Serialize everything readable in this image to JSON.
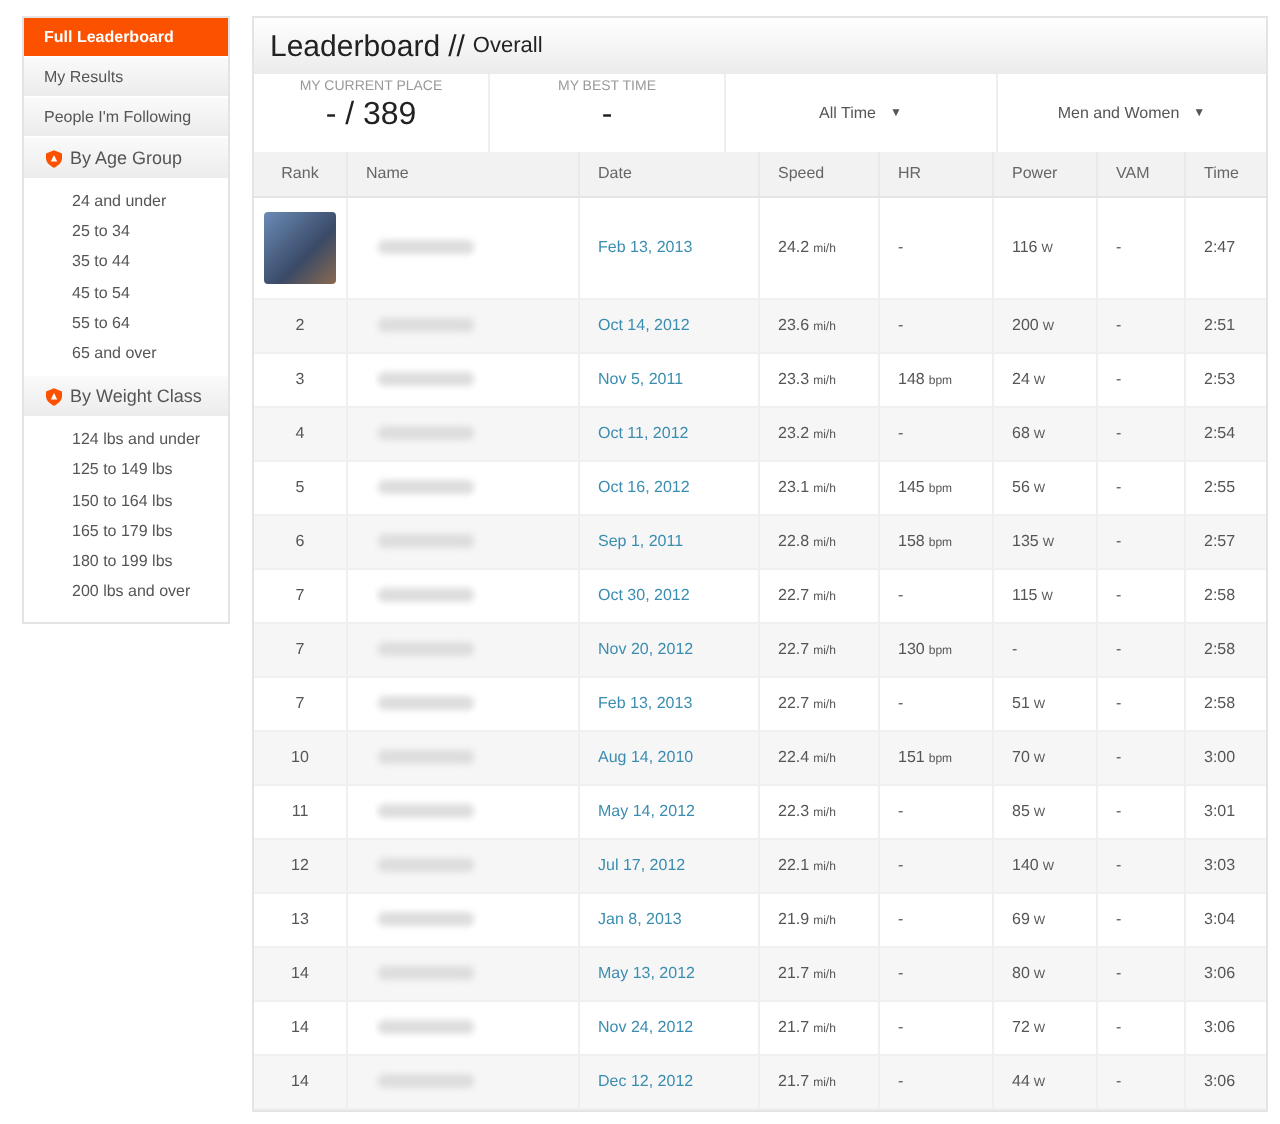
{
  "sidebar": {
    "items": [
      {
        "label": "Full Leaderboard",
        "kind": "link",
        "selected": true
      },
      {
        "label": "My Results",
        "kind": "link",
        "selected": false
      },
      {
        "label": "People I'm Following",
        "kind": "link",
        "selected": false
      },
      {
        "label": "By Age Group",
        "kind": "group",
        "selected": false,
        "children": [
          {
            "label": "24 and under",
            "selected": false
          },
          {
            "label": "25 to 34",
            "selected": false
          },
          {
            "label": "35 to 44",
            "selected": false
          },
          {
            "label": "45 to 54",
            "selected": false
          },
          {
            "label": "55 to 64",
            "selected": false
          },
          {
            "label": "65 and over",
            "selected": false
          }
        ]
      },
      {
        "label": "By Weight Class",
        "kind": "group",
        "selected": false,
        "children": [
          {
            "label": "124 lbs and under",
            "selected": false
          },
          {
            "label": "125 to 149 lbs",
            "selected": false
          },
          {
            "label": "150 to 164 lbs",
            "selected": false
          },
          {
            "label": "165 to 179 lbs",
            "selected": false
          },
          {
            "label": "180 to 199 lbs",
            "selected": false
          },
          {
            "label": "200 lbs and over",
            "selected": false
          }
        ]
      }
    ]
  },
  "header": {
    "title": "Leaderboard",
    "separator": "//",
    "subtitle": "Overall"
  },
  "stats": [
    {
      "label": "MY CURRENT PLACE",
      "value": "- / 389"
    },
    {
      "label": "MY BEST TIME",
      "value": "-"
    }
  ],
  "filters": [
    {
      "label": "All Time",
      "caret": "▼"
    },
    {
      "label": "Men and Women",
      "caret": "▼"
    }
  ],
  "table": {
    "columns": [
      "Rank",
      "Name",
      "Date",
      "Speed",
      "HR",
      "Power",
      "VAM",
      "Time"
    ],
    "rows": [
      {
        "kind": "photo",
        "date": "Feb 13, 2013",
        "speed": {
          "value": "24.2",
          "unit": "mi/h"
        },
        "hr": {
          "value": "-"
        },
        "power": {
          "value": "116",
          "unit": "W"
        },
        "vam": "-",
        "time": "2:47"
      },
      {
        "kind": "rank",
        "rank": "2",
        "date": "Oct 14, 2012",
        "speed": {
          "value": "23.6",
          "unit": "mi/h"
        },
        "hr": {
          "value": "-"
        },
        "power": {
          "value": "200",
          "unit": "W"
        },
        "vam": "-",
        "time": "2:51"
      },
      {
        "kind": "rank",
        "rank": "3",
        "date": "Nov 5, 2011",
        "speed": {
          "value": "23.3",
          "unit": "mi/h"
        },
        "hr": {
          "value": "148",
          "unit": "bpm"
        },
        "power": {
          "value": "24",
          "unit": "W"
        },
        "vam": "-",
        "time": "2:53"
      },
      {
        "kind": "rank",
        "rank": "4",
        "date": "Oct 11, 2012",
        "speed": {
          "value": "23.2",
          "unit": "mi/h"
        },
        "hr": {
          "value": "-"
        },
        "power": {
          "value": "68",
          "unit": "W"
        },
        "vam": "-",
        "time": "2:54"
      },
      {
        "kind": "rank",
        "rank": "5",
        "date": "Oct 16, 2012",
        "speed": {
          "value": "23.1",
          "unit": "mi/h"
        },
        "hr": {
          "value": "145",
          "unit": "bpm"
        },
        "power": {
          "value": "56",
          "unit": "W"
        },
        "vam": "-",
        "time": "2:55"
      },
      {
        "kind": "rank",
        "rank": "6",
        "date": "Sep 1, 2011",
        "speed": {
          "value": "22.8",
          "unit": "mi/h"
        },
        "hr": {
          "value": "158",
          "unit": "bpm"
        },
        "power": {
          "value": "135",
          "unit": "W"
        },
        "vam": "-",
        "time": "2:57"
      },
      {
        "kind": "rank",
        "rank": "7",
        "date": "Oct 30, 2012",
        "speed": {
          "value": "22.7",
          "unit": "mi/h"
        },
        "hr": {
          "value": "-"
        },
        "power": {
          "value": "115",
          "unit": "W"
        },
        "vam": "-",
        "time": "2:58"
      },
      {
        "kind": "rank",
        "rank": "7",
        "date": "Nov 20, 2012",
        "speed": {
          "value": "22.7",
          "unit": "mi/h"
        },
        "hr": {
          "value": "130",
          "unit": "bpm"
        },
        "power": {
          "value": "-"
        },
        "vam": "-",
        "time": "2:58"
      },
      {
        "kind": "rank",
        "rank": "7",
        "date": "Feb 13, 2013",
        "speed": {
          "value": "22.7",
          "unit": "mi/h"
        },
        "hr": {
          "value": "-"
        },
        "power": {
          "value": "51",
          "unit": "W"
        },
        "vam": "-",
        "time": "2:58"
      },
      {
        "kind": "rank",
        "rank": "10",
        "date": "Aug 14, 2010",
        "speed": {
          "value": "22.4",
          "unit": "mi/h"
        },
        "hr": {
          "value": "151",
          "unit": "bpm"
        },
        "power": {
          "value": "70",
          "unit": "W"
        },
        "vam": "-",
        "time": "3:00"
      },
      {
        "kind": "rank",
        "rank": "11",
        "date": "May 14, 2012",
        "speed": {
          "value": "22.3",
          "unit": "mi/h"
        },
        "hr": {
          "value": "-"
        },
        "power": {
          "value": "85",
          "unit": "W"
        },
        "vam": "-",
        "time": "3:01"
      },
      {
        "kind": "rank",
        "rank": "12",
        "date": "Jul 17, 2012",
        "speed": {
          "value": "22.1",
          "unit": "mi/h"
        },
        "hr": {
          "value": "-"
        },
        "power": {
          "value": "140",
          "unit": "W"
        },
        "vam": "-",
        "time": "3:03"
      },
      {
        "kind": "rank",
        "rank": "13",
        "date": "Jan 8, 2013",
        "speed": {
          "value": "21.9",
          "unit": "mi/h"
        },
        "hr": {
          "value": "-"
        },
        "power": {
          "value": "69",
          "unit": "W"
        },
        "vam": "-",
        "time": "3:04"
      },
      {
        "kind": "rank",
        "rank": "14",
        "date": "May 13, 2012",
        "speed": {
          "value": "21.7",
          "unit": "mi/h"
        },
        "hr": {
          "value": "-"
        },
        "power": {
          "value": "80",
          "unit": "W"
        },
        "vam": "-",
        "time": "3:06"
      },
      {
        "kind": "rank",
        "rank": "14",
        "date": "Nov 24, 2012",
        "speed": {
          "value": "21.7",
          "unit": "mi/h"
        },
        "hr": {
          "value": "-"
        },
        "power": {
          "value": "72",
          "unit": "W"
        },
        "vam": "-",
        "time": "3:06"
      },
      {
        "kind": "rank",
        "rank": "14",
        "date": "Dec 12, 2012",
        "speed": {
          "value": "21.7",
          "unit": "mi/h"
        },
        "hr": {
          "value": "-"
        },
        "power": {
          "value": "44",
          "unit": "W"
        },
        "vam": "-",
        "time": "3:06"
      }
    ]
  }
}
